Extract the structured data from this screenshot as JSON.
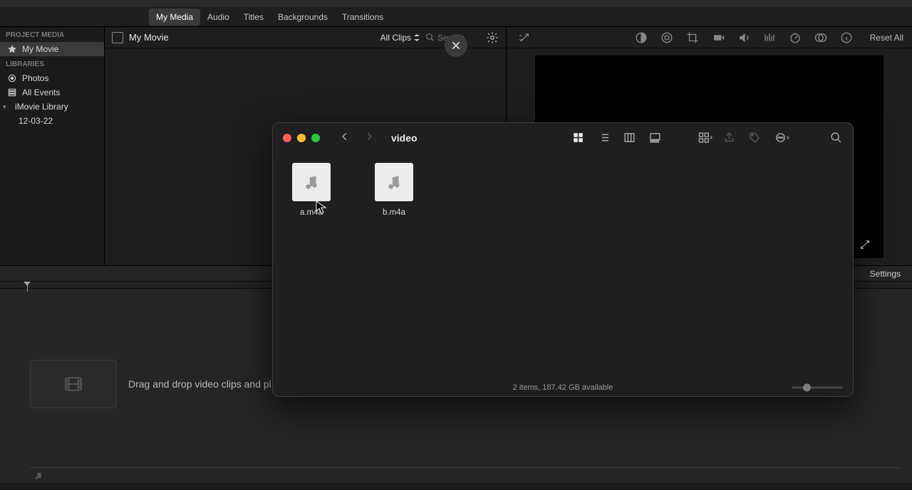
{
  "mediaTabs": {
    "myMedia": "My Media",
    "audio": "Audio",
    "titles": "Titles",
    "backgrounds": "Backgrounds",
    "transitions": "Transitions"
  },
  "sidebar": {
    "projectMedia": "PROJECT MEDIA",
    "myMovie": "My Movie",
    "libraries": "LIBRARIES",
    "photos": "Photos",
    "allEvents": "All Events",
    "imovieLibrary": "iMovie Library",
    "dateItem": "12-03-22"
  },
  "mediaHeader": {
    "title": "My Movie",
    "filter": "All Clips",
    "searchPlaceholder": "Search"
  },
  "viewer": {
    "resetAll": "Reset All"
  },
  "timeline": {
    "settings": "Settings",
    "dropHint": "Drag and drop video clips and pl"
  },
  "finder": {
    "title": "video",
    "files": [
      {
        "name": "a.m4a"
      },
      {
        "name": "b.m4a"
      }
    ],
    "status": "2 items, 187.42 GB available"
  }
}
